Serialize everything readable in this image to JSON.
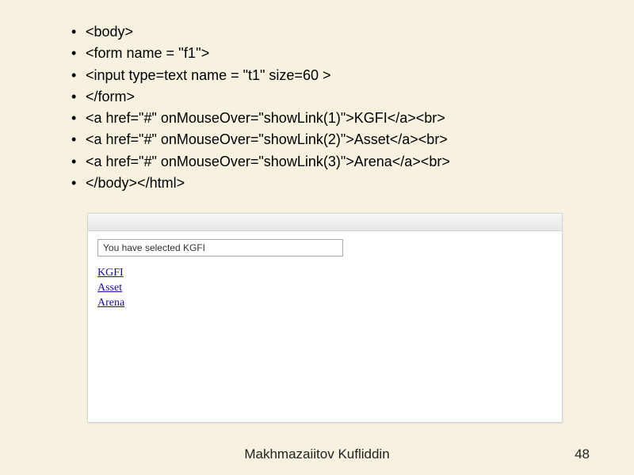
{
  "code_lines": [
    "<body>",
    "<form name = ''f1''>",
    "<input type=text name = \"t1\" size=60 >",
    "</form>",
    "<a href=\"#\" onMouseOver=\"showLink(1)\">KGFI</a><br>",
    "<a href=\"#\" onMouseOver=\"showLink(2)\">Asset</a><br>",
    "<a href=\"#\" onMouseOver=\"showLink(3)\">Arena</a><br>",
    "</body></html>"
  ],
  "preview": {
    "input_value": "You have selected KGFI",
    "links": [
      "KGFI",
      "Asset",
      "Arena"
    ]
  },
  "footer": {
    "author": "Makhmazaiitov Kufliddin",
    "page": "48"
  }
}
